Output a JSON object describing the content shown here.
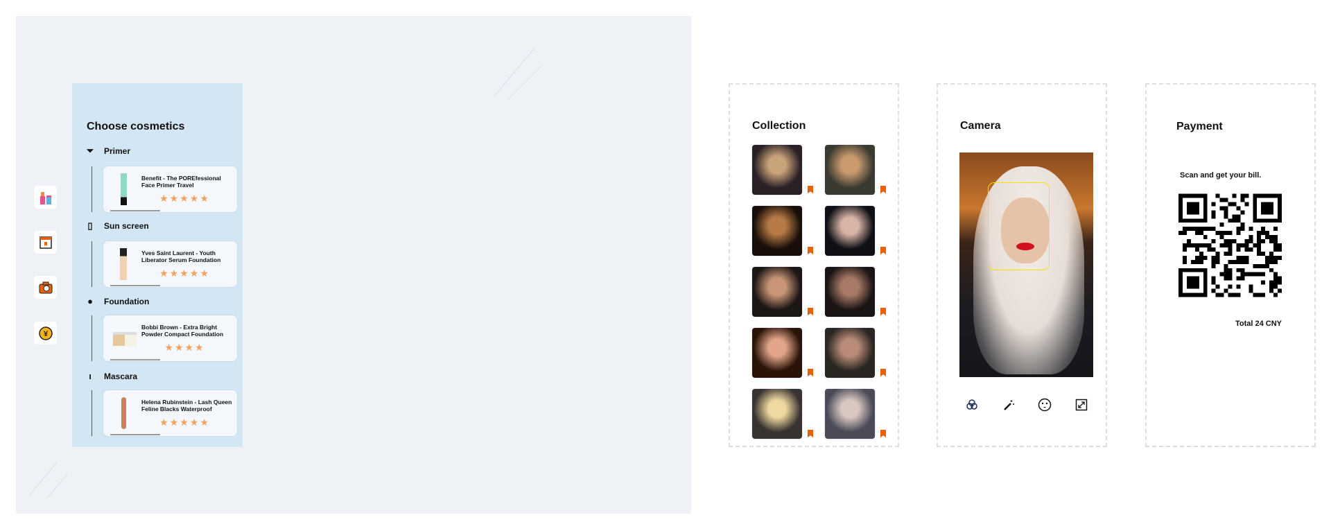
{
  "sidebar": {
    "items": [
      {
        "icon": "cosmetics-icon"
      },
      {
        "icon": "collection-icon"
      },
      {
        "icon": "camera-icon"
      },
      {
        "icon": "payment-yuan-icon"
      }
    ]
  },
  "cosmetics": {
    "title": "Choose cosmetics",
    "categories": [
      {
        "label": "Primer",
        "icon": "primer-tube-icon",
        "product": "Benefit - The POREfessional Face Primer Travel",
        "rating": 5
      },
      {
        "label": "Sun screen",
        "icon": "sunscreen-bottle-icon",
        "product": "Yves Saint Laurent - Youth Liberator Serum Foundation",
        "rating": 5
      },
      {
        "label": "Foundation",
        "icon": "compact-icon",
        "product": "Bobbi Brown - Extra Bright Powder Compact Foundation",
        "rating": 4
      },
      {
        "label": "Mascara",
        "icon": "mascara-icon",
        "product": "Helena Rubinstein - Lash Queen Feline Blacks Waterproof",
        "rating": 5
      }
    ]
  },
  "collection": {
    "title": "Collection",
    "count": 10
  },
  "camera": {
    "title": "Camera",
    "tools": [
      "filters-icon",
      "magic-wand-icon",
      "face-icon",
      "expand-icon"
    ]
  },
  "payment": {
    "title": "Payment",
    "instruction": "Scan and get your bill.",
    "total": "Total 24 CNY"
  },
  "colors": {
    "accent": "#f3a15f",
    "panel": "#d3e6f4",
    "bookmark": "#e8620b",
    "face_frame": "#f5e200"
  }
}
